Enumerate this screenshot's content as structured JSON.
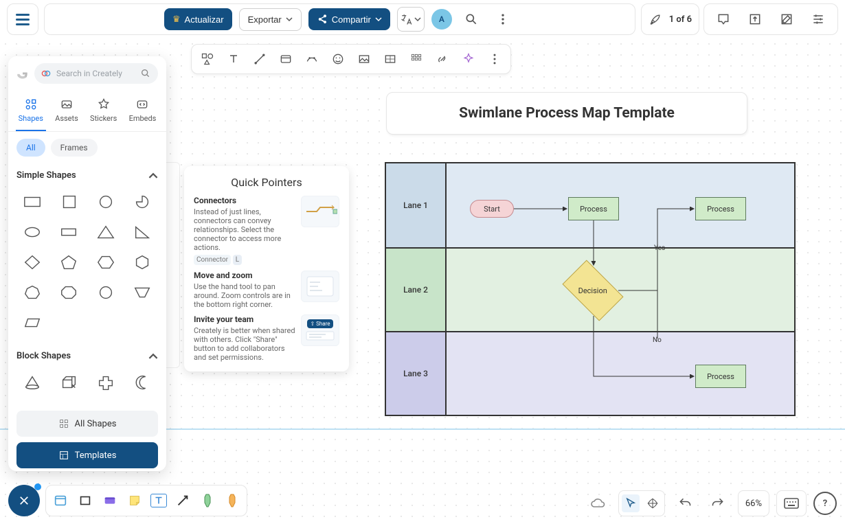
{
  "header": {
    "actualizar": "Actualizar",
    "exportar": "Exportar",
    "compartir": "Compartir",
    "avatar_initial": "A",
    "step_text": "1 of 6"
  },
  "left_panel": {
    "search_placeholder": "Search in Creately",
    "tabs": {
      "shapes": "Shapes",
      "assets": "Assets",
      "stickers": "Stickers",
      "embeds": "Embeds"
    },
    "pills": {
      "all": "All",
      "frames": "Frames"
    },
    "section_simple": "Simple Shapes",
    "section_block": "Block Shapes",
    "all_shapes": "All Shapes",
    "templates": "Templates"
  },
  "quick_pointers": {
    "title": "Quick Pointers",
    "connectors_title": "Connectors",
    "connectors_body": "Instead of just lines, connectors can convey relationships. Select the connector to access more actions.",
    "connector_chip": "Connector",
    "connector_key": "L",
    "move_title": "Move and zoom",
    "move_body": "Use the hand tool to pan around. Zoom controls are in the bottom right corner.",
    "invite_title": "Invite your team",
    "invite_body": "Creately is better when shared with others. Click \"Share\" button to add collaborators and set permissions.",
    "share_chip": "Share"
  },
  "canvas": {
    "title": "Swimlane Process Map Template",
    "lanes": {
      "l1": "Lane 1",
      "l2": "Lane 2",
      "l3": "Lane 3"
    },
    "nodes": {
      "start": "Start",
      "process": "Process",
      "decision": "Decision"
    },
    "labels": {
      "yes": "Yes",
      "no": "No"
    }
  },
  "bottom_right": {
    "zoom": "66%"
  }
}
